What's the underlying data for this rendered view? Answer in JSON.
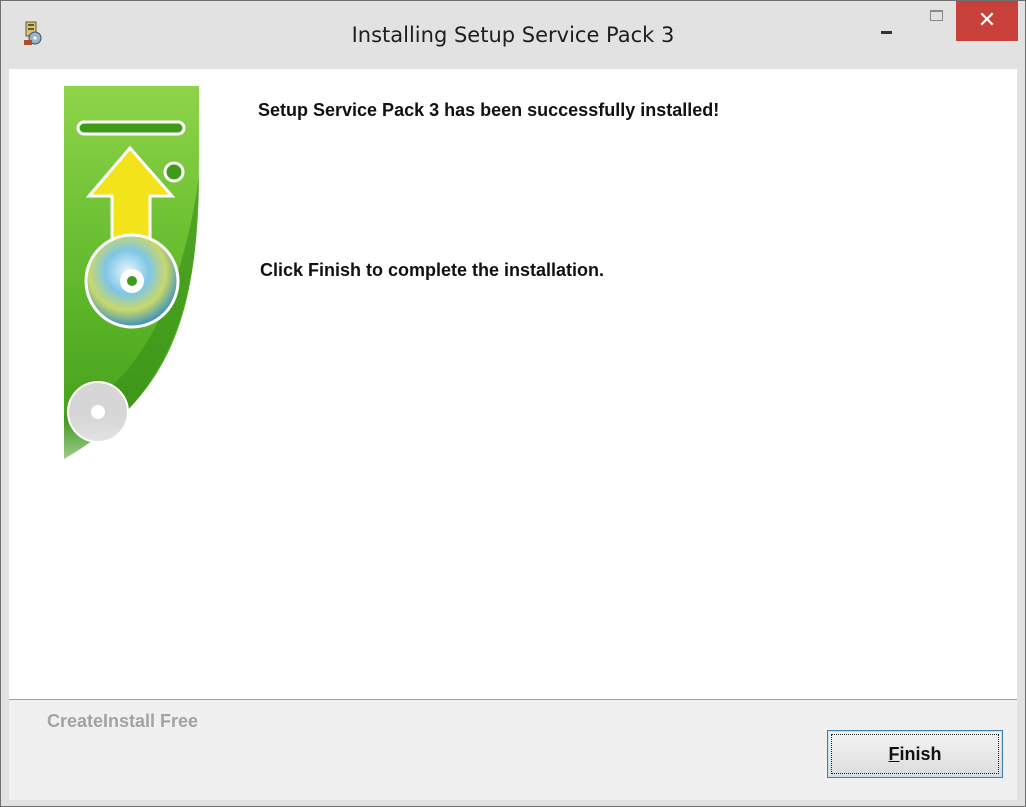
{
  "window": {
    "title": "Installing Setup Service Pack 3",
    "close_glyph": "✕"
  },
  "content": {
    "success_message": "Setup Service Pack 3 has been successfully installed!",
    "instruction": "Click Finish to complete the installation."
  },
  "footer": {
    "brand": "CreateInstall Free",
    "finish_label_accel": "F",
    "finish_label_rest": "inish"
  },
  "icons": {
    "app": "installer-icon",
    "minimize": "minimize-icon",
    "maximize": "maximize-icon",
    "close": "close-icon",
    "side": "green-banner-arrow-disc"
  },
  "colors": {
    "close_button": "#c7403a",
    "banner_green": "#4caf1f",
    "arrow_yellow": "#f2e31b"
  }
}
